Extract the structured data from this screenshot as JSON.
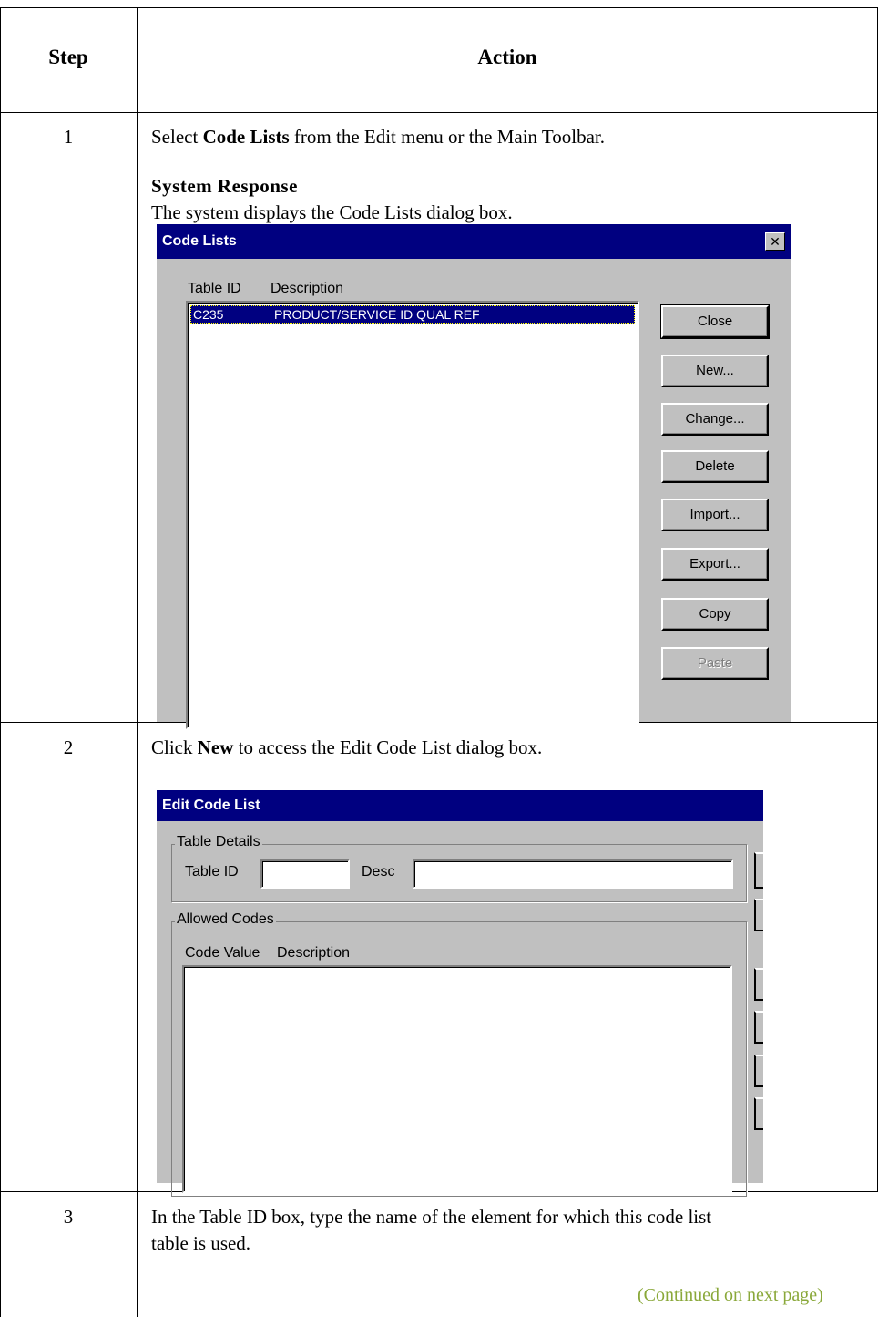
{
  "table": {
    "header_step": "Step",
    "header_action": "Action",
    "continued": "(Continued on next page)"
  },
  "steps": [
    {
      "number": "1",
      "text_pre": "Select ",
      "text_bold": "Code Lists",
      "text_post": " from the Edit menu or the Main Toolbar.",
      "system_response_heading": "System Response",
      "system_response_text": "The system displays the Code Lists dialog box."
    },
    {
      "number": "2",
      "text_pre": "Click ",
      "text_bold": "New",
      "text_post": " to access the Edit Code List dialog box."
    },
    {
      "number": "3",
      "text_line1": "In the Table ID box, type the name of the element for which this code list",
      "text_line2": "table is used."
    }
  ],
  "code_lists_dialog": {
    "title": "Code Lists",
    "close_glyph": "✕",
    "col_table_id": "Table ID",
    "col_description": "Description",
    "rows": [
      {
        "table_id": "C235",
        "description": "PRODUCT/SERVICE ID QUAL REF"
      }
    ],
    "buttons": {
      "close": "Close",
      "new": "New...",
      "change": "Change...",
      "delete": "Delete",
      "import": "Import...",
      "export": "Export...",
      "copy": "Copy",
      "paste": "Paste"
    }
  },
  "edit_code_list_dialog": {
    "title": "Edit Code List",
    "group_table_details": "Table Details",
    "label_table_id": "Table ID",
    "label_desc": "Desc",
    "table_id_value": "",
    "desc_value": "",
    "group_allowed_codes": "Allowed Codes",
    "col_code_value": "Code Value",
    "col_description": "Description"
  }
}
